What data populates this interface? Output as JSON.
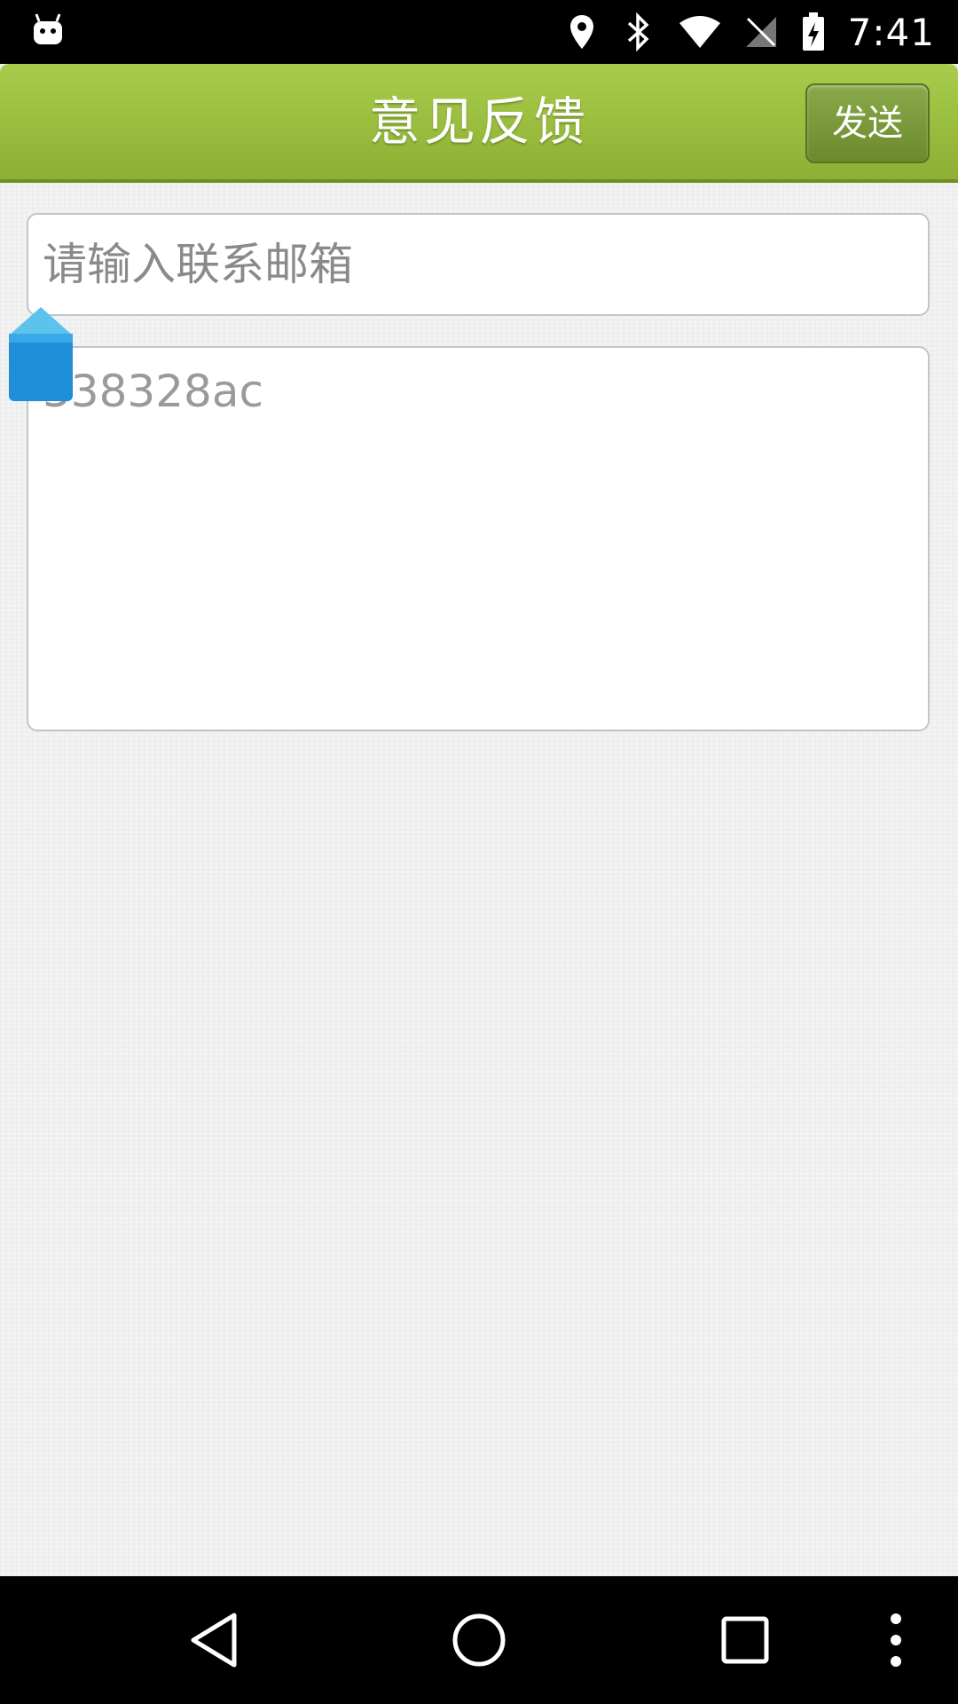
{
  "status_bar": {
    "time": "7:41",
    "icons": [
      "android-debug-icon",
      "location-icon",
      "bluetooth-icon",
      "wifi-icon",
      "no-sim-icon",
      "battery-charging-icon"
    ]
  },
  "header": {
    "title": "意见反馈",
    "send_label": "发送",
    "accent_color": "#9dc13f"
  },
  "form": {
    "email_placeholder": "请输入联系邮箱",
    "feedback_value": "338328ac"
  },
  "nav_bar": {
    "icons": [
      "back-icon",
      "home-icon",
      "recents-icon",
      "menu-dots-icon"
    ]
  }
}
